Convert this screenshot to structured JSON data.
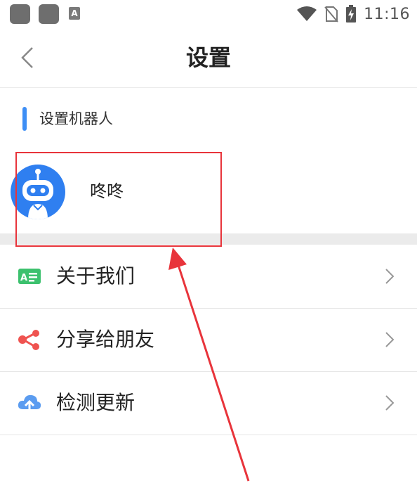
{
  "status_bar": {
    "time": "11:16",
    "app_badge": "A"
  },
  "header": {
    "title": "设置"
  },
  "section": {
    "title": "设置机器人"
  },
  "robot": {
    "name": "咚咚"
  },
  "menu": {
    "items": [
      {
        "label": "关于我们",
        "icon": "about-card-icon"
      },
      {
        "label": "分享给朋友",
        "icon": "share-icon"
      },
      {
        "label": "检测更新",
        "icon": "cloud-upload-icon"
      }
    ]
  },
  "colors": {
    "accent_blue": "#3d8ef5",
    "avatar_blue": "#2f7ff0",
    "about_green": "#3cc16e",
    "share_red": "#ef5350",
    "update_blue": "#5b9cf0",
    "annotation_red": "#e8343b"
  }
}
